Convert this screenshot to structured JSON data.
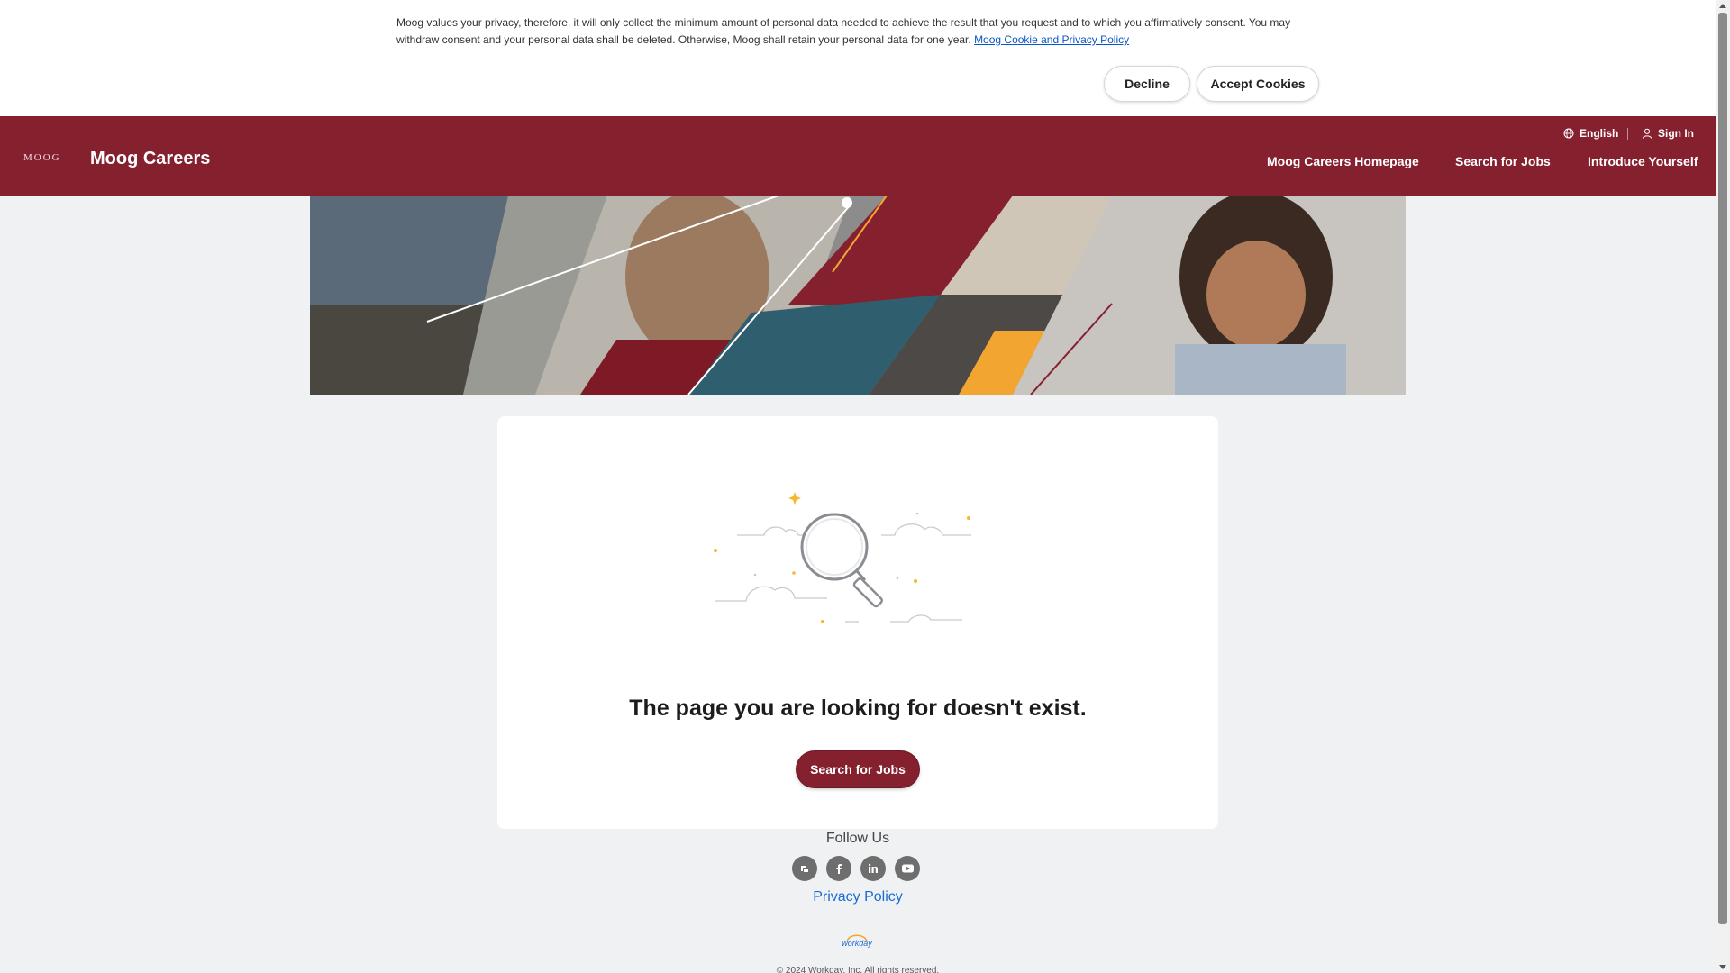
{
  "cookie_banner": {
    "text": "Moog values your privacy, therefore, it will only collect the minimum amount of personal data needed to achieve the result that you request and to which you affirmatively consent. You may withdraw consent and your personal data shall be deleted. Otherwise, Moog shall retain your personal data for one year.",
    "policy_link": "Moog Cookie and Privacy Policy",
    "decline_label": "Decline",
    "accept_label": "Accept Cookies"
  },
  "header": {
    "logo_text": "MOOG",
    "site_title": "Moog Careers",
    "language": "English",
    "sign_in": "Sign In",
    "nav": [
      "Moog Careers Homepage",
      "Search for Jobs",
      "Introduce Yourself"
    ],
    "color": "#85202f"
  },
  "main": {
    "error_title": "The page you are looking for doesn't exist.",
    "search_button": "Search for Jobs"
  },
  "footer": {
    "follow_us": "Follow Us",
    "social_icons": [
      "glassdoor-icon",
      "facebook-icon",
      "linkedin-icon",
      "youtube-icon"
    ],
    "privacy_policy": "Privacy Policy",
    "workday_logo": "workday",
    "copyright": "© 2024 Workday, Inc. All rights reserved."
  }
}
